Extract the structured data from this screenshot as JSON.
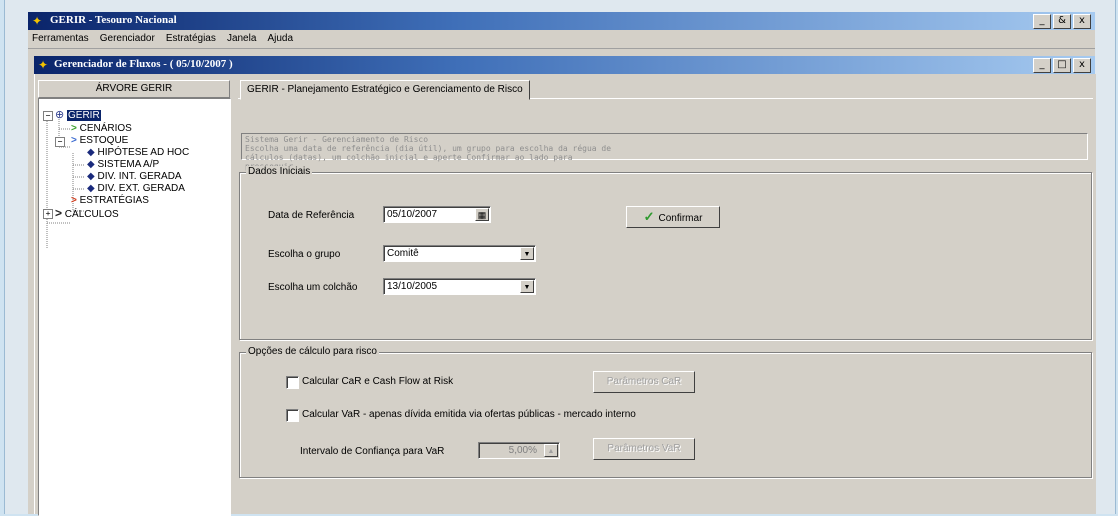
{
  "app": {
    "title": "GERIR - Tesouro Nacional",
    "win_buttons": [
      "_",
      "&",
      "x"
    ]
  },
  "menu": [
    "Ferramentas",
    "Gerenciador",
    "Estratégias",
    "Janela",
    "Ajuda"
  ],
  "child": {
    "title": "Gerenciador de Fluxos - ( 05/10/2007 )",
    "win_buttons": [
      "_",
      "□",
      "x"
    ]
  },
  "tree": {
    "header": "ÁRVORE GERIR",
    "root": "GERIR",
    "items": [
      "CENÁRIOS",
      "ESTOQUE",
      "HIPÓTESE AD HOC",
      "SISTEMA A/P",
      "DIV. INT. GERADA",
      "DIV. EXT. GERADA",
      "ESTRATÉGIAS",
      "CÁLCULOS"
    ]
  },
  "tab": {
    "label": "GERIR - Planejamento Estratégico e Gerenciamento de Risco"
  },
  "description": {
    "line1": "Sistema Gerir - Gerenciamento de Risco",
    "line2": "Escolha uma data de referência (dia útil), um grupo para escolha da régua de",
    "line3": "cálculos (datas), um colchão inicial e aperte Confirmar ao lado para",
    "line4": "prosseguir."
  },
  "dados": {
    "legend": "Dados Iniciais",
    "data_ref_label": "Data de Referência",
    "data_ref_value": "05/10/2007",
    "grupo_label": "Escolha o grupo",
    "grupo_value": "Comitê",
    "colchao_label": "Escolha um colchão",
    "colchao_value": "13/10/2005",
    "confirm": "Confirmar"
  },
  "opcoes": {
    "legend": "Opções de cálculo para risco",
    "car_label": "Calcular CaR e Cash Flow at Risk",
    "car_button": "Parâmetros CaR",
    "var_label": "Calcular VaR - apenas dívida emitida via ofertas públicas - mercado interno",
    "intervalo_label": "Intervalo de Confiança para VaR",
    "intervalo_value": "5,00%",
    "var_button": "Parâmetros VaR"
  },
  "colors": {
    "title_dark": "#0a246a",
    "title_light": "#a6caf0",
    "face": "#d4d0c8"
  }
}
